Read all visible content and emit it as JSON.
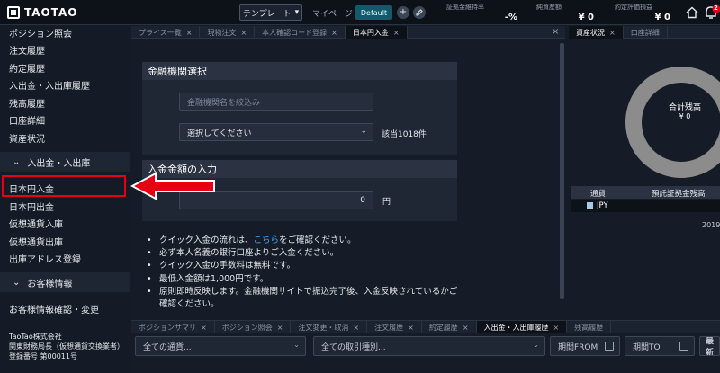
{
  "header": {
    "brand": "TAOTAO",
    "template_label": "テンプレート",
    "mypage_label": "マイページ",
    "default_label": "Default",
    "add_symbol": "+",
    "stats": [
      {
        "label": "証拠金維持率",
        "value": "-%"
      },
      {
        "label": "純資産額",
        "value": "¥ 0"
      },
      {
        "label": "約定評価損益",
        "value": "¥ 0"
      }
    ],
    "notification_count": "2"
  },
  "sidebar": {
    "items_top": [
      "ポジション照会",
      "注文履歴",
      "約定履歴",
      "入出金・入出庫履歴",
      "残高履歴",
      "口座詳細",
      "資産状況"
    ],
    "section_deposit": "入出金・入出庫",
    "items_deposit": [
      "日本円入金",
      "日本円出金",
      "仮想通貨入庫",
      "仮想通貨出庫",
      "出庫アドレス登録"
    ],
    "section_customer": "お客様情報",
    "items_customer": [
      "お客様情報確認・変更"
    ],
    "company": [
      "TaoTao株式会社",
      "関東財務局長（仮想通貨交換業者）",
      "登録番号 第00011号"
    ]
  },
  "main": {
    "tabs": [
      {
        "label": "プライス一覧",
        "close": "×"
      },
      {
        "label": "現物注文",
        "close": "×"
      },
      {
        "label": "本人確認コード登録",
        "close": "×"
      },
      {
        "label": "日本円入金",
        "close": "×"
      }
    ],
    "close_symbol": "×",
    "bank_section": "金融機関選択",
    "bank_search_placeholder": "金融機関名を絞込み",
    "bank_select_value": "選択してください",
    "bank_count": "該当1018件",
    "amount_section": "入金金額の入力",
    "amount_value": "0",
    "amount_unit": "円",
    "notes": {
      "n1_pre": "クイック入金の流れは、",
      "n1_link": "こちら",
      "n1_post": "をご確認ください。",
      "n2": "必ず本人名義の銀行口座よりご入金ください。",
      "n3": "クイック入金の手数料は無料です。",
      "n4": "最低入金額は1,000円です。",
      "n5a": "原則即時反映します。金融機関サイトで振込完了後、入金反映されているかご",
      "n5b": "確認ください。"
    }
  },
  "right": {
    "tabs": [
      {
        "label": "資産状況",
        "close": "×"
      },
      {
        "label": "口座詳細",
        "close": ""
      }
    ],
    "donut_title": "合計残高",
    "donut_value": "¥ 0",
    "table_headers": [
      "通貨",
      "預託証拠金残高"
    ],
    "row_currency": "JPY",
    "year": "2019"
  },
  "bottom": {
    "tabs": [
      {
        "label": "ポジションサマリ",
        "close": "×"
      },
      {
        "label": "ポジション照会",
        "close": "×"
      },
      {
        "label": "注文変更・取消",
        "close": "×"
      },
      {
        "label": "注文履歴",
        "close": "×"
      },
      {
        "label": "約定履歴",
        "close": "×"
      },
      {
        "label": "入出金・入出庫履歴",
        "close": "×"
      },
      {
        "label": "残高履歴",
        "close": ""
      }
    ],
    "filter_currency": "全ての通貨...",
    "filter_type": "全ての取引種別...",
    "filter_from": "期間FROM",
    "filter_to": "期間TO",
    "update_label": "最新"
  },
  "colors": {
    "highlight": "#e60012",
    "accent": "#125a6b",
    "link": "#4da3ff"
  }
}
